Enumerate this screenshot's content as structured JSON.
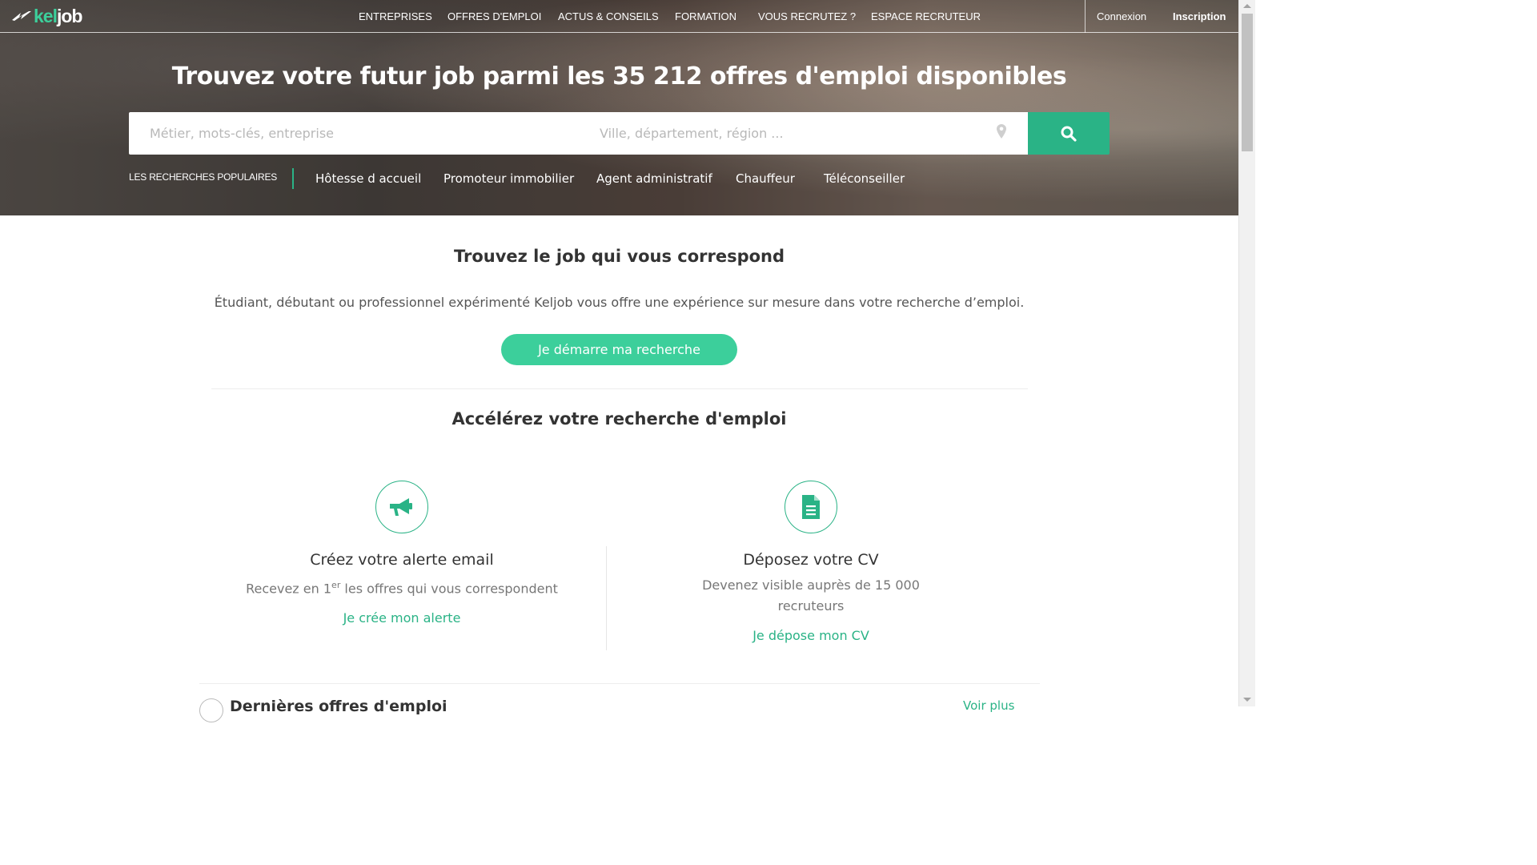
{
  "brand": {
    "logo_part1": "kel",
    "logo_part2": "job",
    "accent_color": "#2ab386",
    "button_color": "#3ccf9b"
  },
  "nav": {
    "items": [
      "ENTREPRISES",
      "OFFRES D'EMPLOI",
      "ACTUS & CONSEILS",
      "FORMATION",
      "VOUS RECRUTEZ ?",
      "ESPACE RECRUTEUR"
    ],
    "login": "Connexion",
    "signup": "Inscription"
  },
  "hero": {
    "title_before": "Trouvez votre futur job parmi les ",
    "title_bold": "35 212 offres d'emploi",
    "title_after": " disponibles"
  },
  "search": {
    "what_placeholder": "Métier, mots-clés, entreprise",
    "where_placeholder": "Ville, département, région ...",
    "button_icon": "search-icon",
    "location_icon": "map-pin-icon"
  },
  "popular": {
    "label": "LES RECHERCHES POPULAIRES",
    "items": [
      "Hôtesse d accueil",
      "Promoteur immobilier",
      "Agent administratif",
      "Chauffeur",
      "Téléconseiller"
    ]
  },
  "intro": {
    "title": "Trouvez le job qui vous correspond",
    "text": "Étudiant, débutant ou professionnel expérimenté Keljob vous offre une expérience sur mesure dans votre recherche d’emploi.",
    "button": "Je démarre ma recherche"
  },
  "accelerate": {
    "title": "Accélérez votre recherche d'emploi",
    "features": [
      {
        "icon": "megaphone-icon",
        "title": "Créez votre alerte email",
        "desc_before": "Recevez en 1",
        "desc_sup": "er",
        "desc_after": " les offres qui vous correspondent",
        "link": "Je crée mon alerte"
      },
      {
        "icon": "document-icon",
        "title": "Déposez votre CV",
        "desc_before": "Devenez visible auprès de 15 000 recruteurs",
        "desc_sup": "",
        "desc_after": "",
        "link": "Je dépose mon CV"
      }
    ]
  },
  "bottom": {
    "title": "Dernières offres d'emploi",
    "link": "Voir plus"
  }
}
